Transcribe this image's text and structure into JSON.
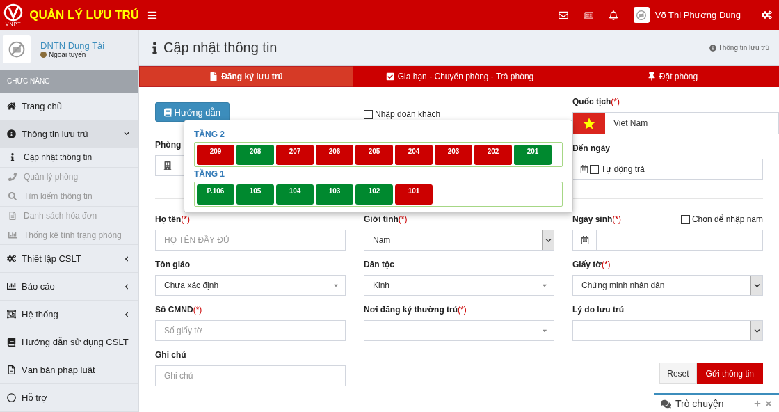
{
  "header": {
    "logo_text": "VNPT",
    "title": "QUẢN LÝ LƯU TRÚ",
    "user_name": "Võ Thị Phương Dung"
  },
  "sidebar": {
    "org_name": "DNTN Dung Tài",
    "status": "Ngoại tuyến",
    "section_label": "CHỨC NĂNG",
    "items": [
      {
        "kind": "link",
        "label": "Trang chủ"
      },
      {
        "kind": "group",
        "label": "Thông tin lưu trú",
        "expanded": true,
        "children": [
          {
            "label": "Cập nhật thông tin",
            "selected": true
          },
          {
            "label": "Quản lý phòng",
            "selected": false
          },
          {
            "label": "Tìm kiếm thông tin",
            "selected": false
          },
          {
            "label": "Danh sách hóa đơn",
            "selected": false
          },
          {
            "label": "Thống kê tình trạng phòng",
            "selected": false
          }
        ]
      },
      {
        "kind": "group",
        "label": "Thiết lập CSLT",
        "expanded": false
      },
      {
        "kind": "group",
        "label": "Báo cáo",
        "expanded": false
      },
      {
        "kind": "group",
        "label": "Hệ thống",
        "expanded": false
      },
      {
        "kind": "link",
        "label": "Hướng dẫn sử dụng CSLT"
      },
      {
        "kind": "link",
        "label": "Văn bản pháp luật"
      },
      {
        "kind": "link",
        "label": "Hỗ trợ"
      }
    ]
  },
  "page": {
    "title": "Cập nhật thông tin",
    "breadcrumb": "Thông tin lưu trú"
  },
  "tabs": [
    {
      "label": "Đăng ký lưu trú",
      "selected": true
    },
    {
      "label": "Gia hạn - Chuyển phòng - Trả phòng",
      "selected": false
    },
    {
      "label": "Đặt phòng",
      "selected": false
    }
  ],
  "top": {
    "guide_button": "Hướng dẫn",
    "group_checkbox": {
      "label": "Nhập đoàn khách",
      "checked": false
    },
    "nationality": {
      "label": "Quốc tịch",
      "required_mark": "(*)",
      "value": "Viet Nam"
    },
    "room": {
      "label": "Phòng"
    },
    "to_date": {
      "label": "Đến ngày",
      "auto_checkbox": {
        "label": "Tự động trả",
        "checked": false
      }
    }
  },
  "room_picker": {
    "floors": [
      {
        "name": "TẦNG 2",
        "rooms": [
          {
            "number": "209",
            "color": "#cc0000"
          },
          {
            "number": "208",
            "color": "#00892f"
          },
          {
            "number": "207",
            "color": "#cc0000"
          },
          {
            "number": "206",
            "color": "#cc0000"
          },
          {
            "number": "205",
            "color": "#cc0000"
          },
          {
            "number": "204",
            "color": "#cc0000"
          },
          {
            "number": "203",
            "color": "#cc0000"
          },
          {
            "number": "202",
            "color": "#cc0000"
          },
          {
            "number": "201",
            "color": "#00892f"
          }
        ]
      },
      {
        "name": "TẦNG 1",
        "rooms": [
          {
            "number": "P.106",
            "color": "#00892f"
          },
          {
            "number": "105",
            "color": "#00892f"
          },
          {
            "number": "104",
            "color": "#00892f"
          },
          {
            "number": "103",
            "color": "#00892f"
          },
          {
            "number": "102",
            "color": "#00892f"
          },
          {
            "number": "101",
            "color": "#cc0000"
          }
        ]
      }
    ]
  },
  "fields": [
    {
      "kind": "text",
      "label": "Họ tên",
      "required_mark": "(*)",
      "placeholder": "HỌ TÊN ĐẦY ĐỦ"
    },
    {
      "kind": "native",
      "label": "Giới tính",
      "required_mark": "(*)",
      "value": "Nam"
    },
    {
      "kind": "date",
      "label": "Ngày sinh",
      "required_mark": "(*)",
      "checkbox": {
        "label": "Chọn để nhập năm",
        "checked": false
      }
    },
    {
      "kind": "select",
      "label": "Tôn giáo",
      "value": "Chưa xác định"
    },
    {
      "kind": "select",
      "label": "Dân tộc",
      "value": "Kinh"
    },
    {
      "kind": "native",
      "label": "Giấy tờ",
      "required_mark": "(*)",
      "value": "Chứng minh nhân dân"
    },
    {
      "kind": "text",
      "label": "Số CMND",
      "required_mark": "(*)",
      "placeholder": "Số giấy tờ"
    },
    {
      "kind": "select",
      "label": "Nơi đăng ký thường trú",
      "required_mark": "(*)"
    },
    {
      "kind": "native",
      "label": "Lý do lưu trú"
    },
    {
      "kind": "text",
      "label": "Ghi chú",
      "placeholder": "Ghi chú"
    }
  ],
  "buttons": {
    "reset": "Reset",
    "submit": "Gửi thông tin"
  },
  "chat": {
    "title": "Trò chuyện"
  }
}
